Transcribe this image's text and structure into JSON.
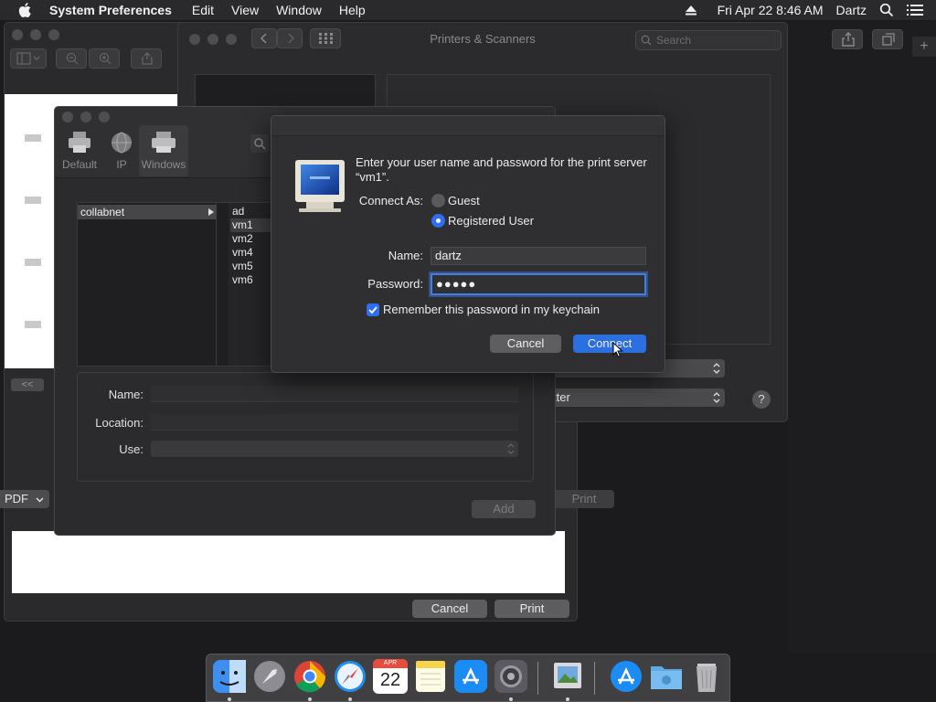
{
  "menubar": {
    "app_name": "System Preferences",
    "items": [
      "Edit",
      "View",
      "Window",
      "Help"
    ],
    "clock": "Fri Apr 22  8:46 AM",
    "user": "Dartz"
  },
  "printers_window": {
    "title": "Printers & Scanners",
    "search_placeholder": "Search",
    "driver_select_label": "tter",
    "help_label": "?"
  },
  "print_window": {
    "pdf_label": "PDF",
    "collapse_label": "<<",
    "cancel_label": "Cancel",
    "print_label": "Print",
    "print_dim_label": "Print"
  },
  "add_printer_window": {
    "toolbar": [
      {
        "label": "Default",
        "icon": "printer-icon"
      },
      {
        "label": "IP",
        "icon": "globe-icon"
      },
      {
        "label": "Windows",
        "icon": "windows-printer-icon"
      }
    ],
    "workgroup": "collabnet",
    "servers": [
      "ad",
      "vm1",
      "vm2",
      "vm4",
      "vm5",
      "vm6"
    ],
    "selected_server": "vm1",
    "fields": {
      "name_label": "Name:",
      "location_label": "Location:",
      "use_label": "Use:"
    },
    "add_label": "Add"
  },
  "auth_dialog": {
    "message": "Enter your user name and password for the print server “vm1”.",
    "connect_as_label": "Connect As:",
    "options": [
      "Guest",
      "Registered User"
    ],
    "selected_option": "Registered User",
    "name_label": "Name:",
    "name_value": "dartz",
    "password_label": "Password:",
    "password_value": "●●●●●",
    "remember_label": "Remember this password in my keychain",
    "remember_checked": true,
    "cancel_label": "Cancel",
    "connect_label": "Connect"
  },
  "dock": {
    "calendar_month": "APR",
    "calendar_day": "22"
  },
  "colors": {
    "accent": "#2b6fe0",
    "window_bg": "#2b2b2d"
  }
}
